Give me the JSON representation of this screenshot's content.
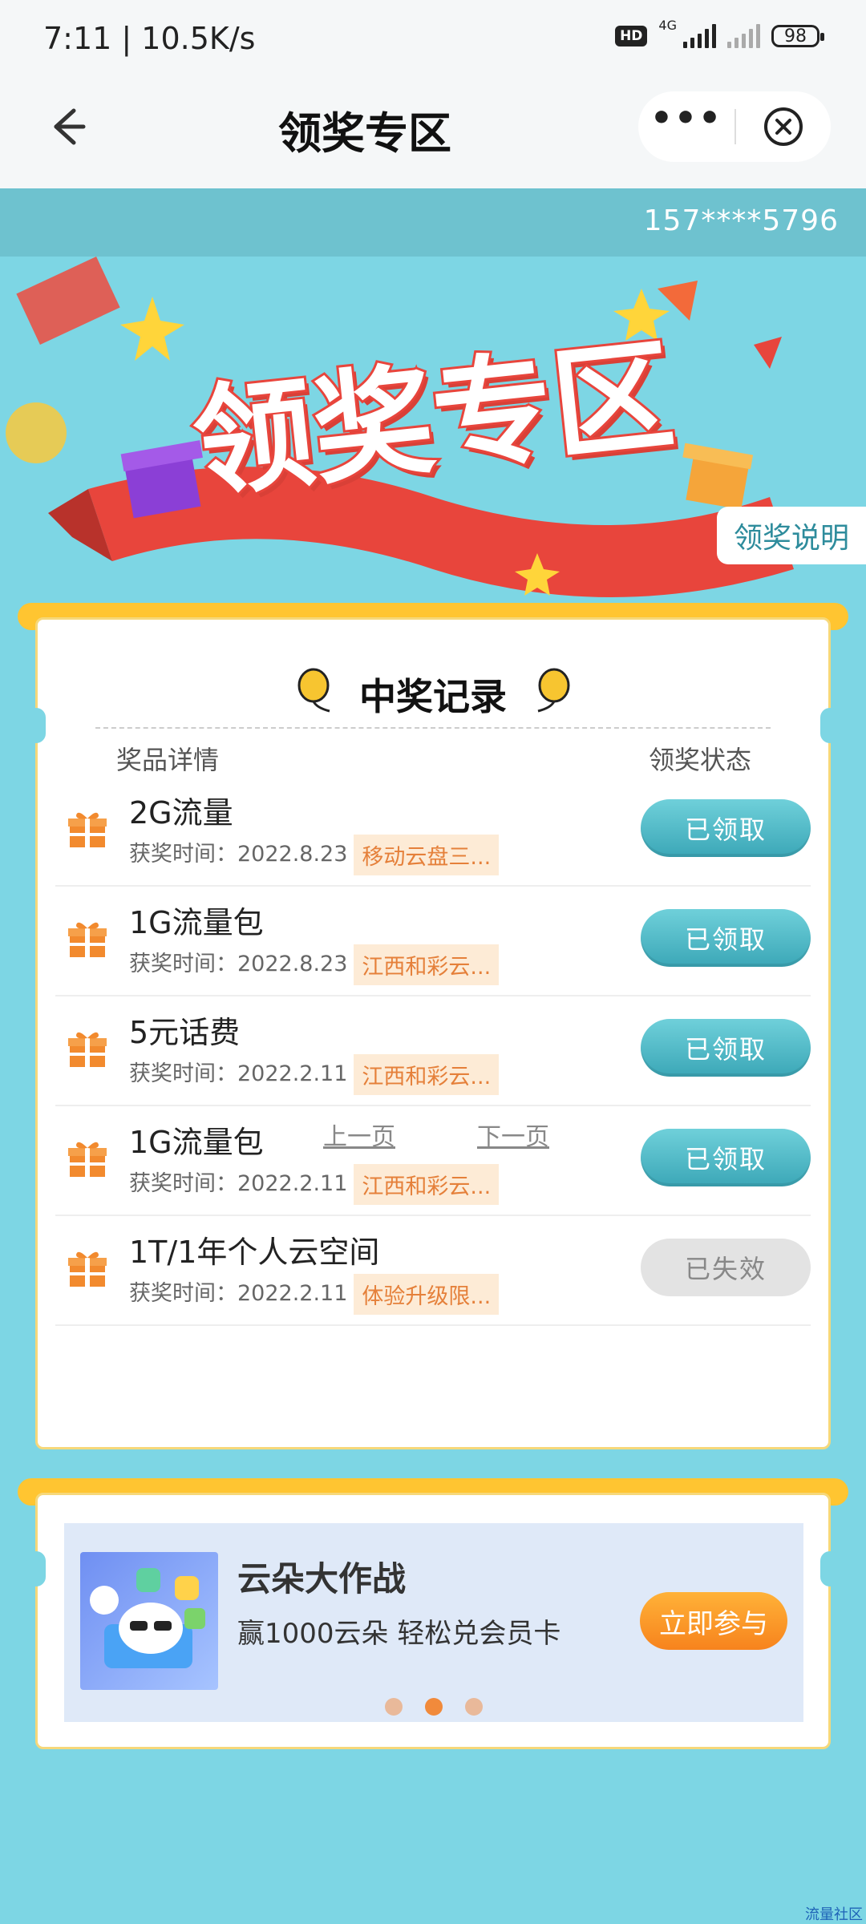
{
  "status_bar": {
    "time": "7:11 | 10.5K/s",
    "hd": "HD",
    "network": "4G",
    "battery": "98"
  },
  "nav": {
    "title": "领奖专区",
    "more_label": "•••"
  },
  "account": {
    "phone": "157****5796"
  },
  "banner": {
    "title": "领奖专区",
    "rules_tab": "领奖说明"
  },
  "records": {
    "title": "中奖记录",
    "col_prize": "奖品详情",
    "col_status": "领奖状态",
    "items": [
      {
        "name": "2G流量",
        "date": "获奖时间：2022.8.23",
        "tag": "移动云盘三...",
        "status": "已领取",
        "state": "claimed"
      },
      {
        "name": "1G流量包",
        "date": "获奖时间：2022.8.23",
        "tag": "江西和彩云...",
        "status": "已领取",
        "state": "claimed"
      },
      {
        "name": "5元话费",
        "date": "获奖时间：2022.2.11",
        "tag": "江西和彩云...",
        "status": "已领取",
        "state": "claimed"
      },
      {
        "name": "1G流量包",
        "date": "获奖时间：2022.2.11",
        "tag": "江西和彩云...",
        "status": "已领取",
        "state": "claimed"
      },
      {
        "name": "1T/1年个人云空间",
        "date": "获奖时间：2022.2.11",
        "tag": "体验升级限...",
        "status": "已失效",
        "state": "expired"
      }
    ],
    "prev_page": "上一页",
    "next_page": "下一页"
  },
  "promo": {
    "title": "云朵大作战",
    "desc": "赢1000云朵 轻松兑会员卡",
    "button": "立即参与",
    "dots_active_index": 1
  },
  "watermark": "流量社区",
  "colors": {
    "background": "#7dd6e4",
    "frame": "#ffc531",
    "claimed": "#3ba7b7",
    "accent_orange": "#f7831d",
    "tag_bg": "#fdebd6",
    "tag_text": "#e5803a"
  }
}
